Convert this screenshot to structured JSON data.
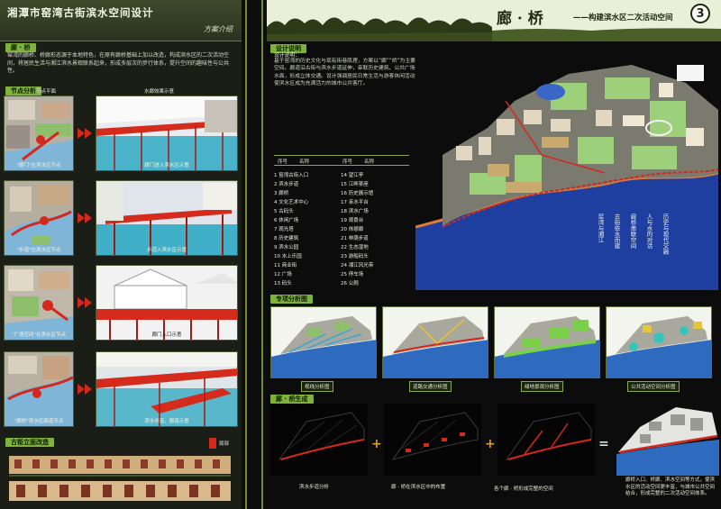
{
  "left": {
    "title": "湘潭市窑湾古街滨水空间设计",
    "subtitle": "方案介绍",
    "section_intro": "廊 · 桥",
    "intro_text": "窑湾的廊桥、桥廊形态源于本地特色，在原有廊桥基础上加以改造，构成滨水区的二次活动空间，将居民生活与湘江滨水景观联系起来，形成多层次的步行体系，提升空间的趣味性与公共性。",
    "section_nodes": "节点分析",
    "node_headers": [
      "节点平面",
      "水廊效果示意"
    ],
    "rows": [
      {
        "plan_caption": "\"廊门\"在滨水区节点",
        "view_caption": "廊门进入滨水区示意"
      },
      {
        "plan_caption": "\"步道\"在滨水区节点",
        "view_caption": "步道入滨水区示意"
      },
      {
        "plan_caption": "\"广场空间\"在滨水区节点",
        "view_caption": "廊门入口示意"
      },
      {
        "plan_caption": "\"廊桥\"滨水区廊道节点",
        "view_caption": "滨水步道、廊道示意"
      }
    ],
    "section_elevation": "古街立面改造",
    "elevation_tag": "局部"
  },
  "right": {
    "title": "廊 · 桥",
    "subtitle": "——构建滨水区二次活动空间",
    "number": "3",
    "section_design": "设计说明",
    "design_label": "设计说明：",
    "design_text": "基于窑湾的历史文化与现有街巷肌理，方案以“廊”“桥”为主要元素，在湘江滨水区构建二次活动空间。廊道沿古街与滨水步道延伸，串联历史建筑、公共广场与码头节点；桥体跨越地形高差与水面，形成立体交通。设计强调居民日常生活与游客休闲活动的结合，通过多层次的空间组织，使滨水区成为充满活力的城市公共客厅。",
    "legend_header": [
      "序号",
      "名称",
      "序号",
      "名称"
    ],
    "legend": [
      [
        "1 窑湾古街入口",
        "14 望江亭"
      ],
      [
        "2 滨水步道",
        "15 江畔茶座"
      ],
      [
        "3 廊桥",
        "16 历史展示馆"
      ],
      [
        "4 文化艺术中心",
        "17 亲水平台"
      ],
      [
        "5 古码头",
        "18 滨水广场"
      ],
      [
        "6 休闲广场",
        "19 观景台"
      ],
      [
        "7 观光塔",
        "20 休憩廊"
      ],
      [
        "8 历史建筑",
        "21 林荫步道"
      ],
      [
        "9 滨水公园",
        "22 生态湿地"
      ],
      [
        "10 水上乐园",
        "23 游船码头"
      ],
      [
        "11 商业街",
        "24 湘江风光带"
      ],
      [
        "12 广场",
        "25 停车场"
      ],
      [
        "13 码头",
        "26 公厕"
      ]
    ],
    "section_analysis": "专项分析图",
    "analysis_captions": [
      "视线分析图",
      "道路交通分析图",
      "绿地景观分析图",
      "公共活动空间分析图"
    ],
    "section_generation": "廊 · 桥生成",
    "generation_captions": [
      "滨水步道分析",
      "廊 · 桥在滨水区中的布置",
      "各个廊 · 桥形成完整的空间"
    ],
    "vertical_texts": [
      "窑湾与湘江",
      "古街依水而建",
      "廊桥串联空间",
      "人与水的对话",
      "历史与现代交融"
    ],
    "final_text": "廊桥入口、桥廊、滨水空间等方式，使滨水区的活动空间更丰富，与城市公共空间结合，形成完整的二次活动空间体系。"
  },
  "colors": {
    "accent_green": "#7db33a",
    "accent_red": "#d4281c",
    "water_blue": "#1e3fa0",
    "plus_orange": "#e09a2a"
  }
}
